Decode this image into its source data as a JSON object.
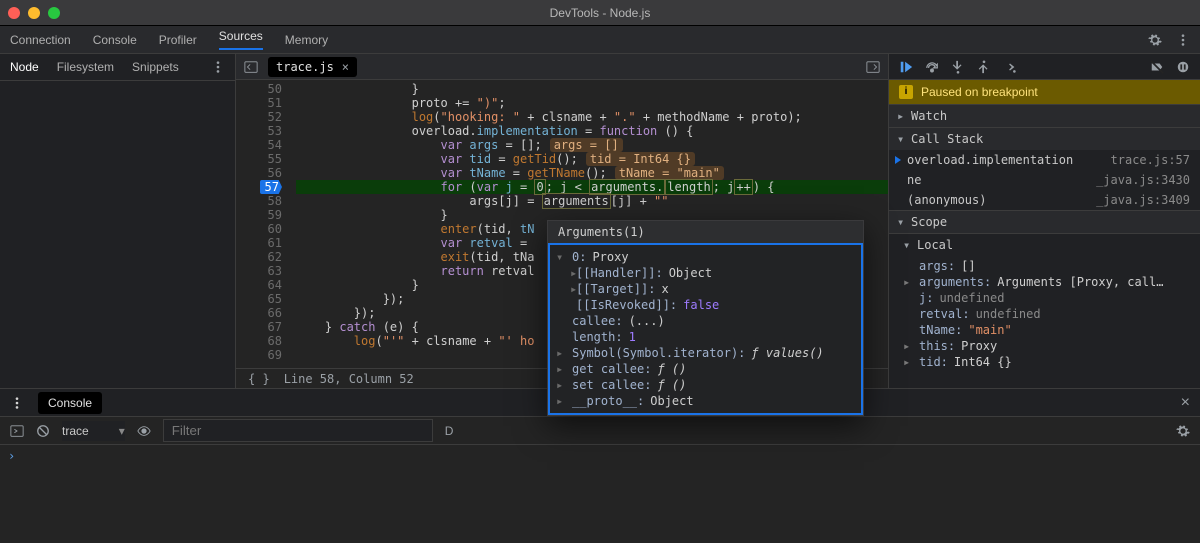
{
  "window": {
    "title": "DevTools - Node.js"
  },
  "mainTabs": [
    "Connection",
    "Console",
    "Profiler",
    "Sources",
    "Memory"
  ],
  "mainTabActive": 3,
  "subTabs": [
    "Node",
    "Filesystem",
    "Snippets"
  ],
  "subTabActive": 0,
  "fileTab": {
    "name": "trace.js"
  },
  "status": "Line 58, Column 52",
  "paused": "Paused on breakpoint",
  "watch": "Watch",
  "callStackLabel": "Call Stack",
  "scopeLabel": "Scope",
  "callStack": [
    {
      "name": "overload.implementation",
      "loc": "trace.js:57",
      "current": true
    },
    {
      "name": "ne",
      "loc": "_java.js:3430",
      "current": false
    },
    {
      "name": "(anonymous)",
      "loc": "_java.js:3409",
      "current": false
    }
  ],
  "localLabel": "Local",
  "scope": [
    {
      "tri": "",
      "k": "args:",
      "v": "[]",
      "cls": "val"
    },
    {
      "tri": "▸",
      "k": "arguments:",
      "v": "Arguments [Proxy, call…",
      "cls": "val"
    },
    {
      "tri": "",
      "k": "j:",
      "v": "undefined",
      "cls": "undef"
    },
    {
      "tri": "",
      "k": "retval:",
      "v": "undefined",
      "cls": "undef"
    },
    {
      "tri": "",
      "k": "tName:",
      "v": "\"main\"",
      "cls": "str"
    },
    {
      "tri": "▸",
      "k": "this:",
      "v": "Proxy",
      "cls": "val"
    },
    {
      "tri": "▸",
      "k": "tid:",
      "v": "Int64 {}",
      "cls": "val"
    }
  ],
  "code": {
    "start": 50,
    "bpLine": 57,
    "lines": [
      {
        "n": 50,
        "indent": 16,
        "html": "}"
      },
      {
        "n": 51,
        "indent": 16,
        "html": "proto += <span class='tok-str'>\")\"</span>;"
      },
      {
        "n": 52,
        "indent": 16,
        "html": "<span class='tok-fn'>log</span>(<span class='tok-str'>\"hooking: \"</span> + clsname + <span class='tok-str'>\".\"</span> + methodName + proto);"
      },
      {
        "n": 53,
        "indent": 16,
        "html": "overload.<span class='tok-id'>implementation</span> = <span class='tok-kw'>function</span> () {"
      },
      {
        "n": 54,
        "indent": 20,
        "html": "<span class='tok-kw'>var</span> <span class='tok-id'>args</span> = [];<span class='inl'>args = []</span>"
      },
      {
        "n": 55,
        "indent": 20,
        "html": "<span class='tok-kw'>var</span> <span class='tok-id'>tid</span> = <span class='tok-fn'>getTid</span>();<span class='inl'>tid = Int64 {}</span>"
      },
      {
        "n": 56,
        "indent": 20,
        "html": "<span class='tok-kw'>var</span> <span class='tok-id'>tName</span> = <span class='tok-fn'>getTName</span>();<span class='inl'>tName = \"main\"</span>"
      },
      {
        "n": 57,
        "indent": 20,
        "exec": true,
        "html": "<span class='tok-kw'>for</span> (<span class='tok-kw'>var</span> <span class='tok-id'>j</span> = <span class='hl-box'>0</span>; j &lt; <span class='hl-box'>arguments.</span><span class='hl-box'>length</span>; j<span class='hl-box'>++</span>) {"
      },
      {
        "n": 58,
        "indent": 24,
        "html": "args[j] = <span class='hl-box'>arguments</span>[j] + <span class='tok-str'>\"\"</span>"
      },
      {
        "n": 59,
        "indent": 20,
        "html": "}"
      },
      {
        "n": 60,
        "indent": 20,
        "html": "<span class='tok-fn'>enter</span>(tid, <span class='tok-id'>tN</span>"
      },
      {
        "n": 61,
        "indent": 20,
        "html": "<span class='tok-kw'>var</span> <span class='tok-id'>retval</span> ="
      },
      {
        "n": 62,
        "indent": 20,
        "html": "<span class='tok-fn'>exit</span>(tid, tNa"
      },
      {
        "n": 63,
        "indent": 20,
        "html": "<span class='tok-kw'>return</span> retval"
      },
      {
        "n": 64,
        "indent": 16,
        "html": "}"
      },
      {
        "n": 65,
        "indent": 12,
        "html": "});"
      },
      {
        "n": 66,
        "indent": 8,
        "html": "});"
      },
      {
        "n": 67,
        "indent": 4,
        "html": "} <span class='tok-kw'>catch</span> (e) {"
      },
      {
        "n": 68,
        "indent": 8,
        "html": "<span class='tok-fn'>log</span>(<span class='tok-str'>\"'\"</span> + clsname + <span class='tok-str'>\"' ho</span>"
      },
      {
        "n": 69,
        "indent": 4,
        "html": ""
      }
    ]
  },
  "tooltip": {
    "title": "Arguments(1)",
    "rows": [
      {
        "tri": "▾",
        "k": "0:",
        "v": "Proxy",
        "cls": "v"
      },
      {
        "tri": "▸",
        "k": "[[Handler]]:",
        "v": "Object",
        "cls": "v",
        "pad": 1
      },
      {
        "tri": "▸",
        "k": "[[Target]]:",
        "v": "x",
        "cls": "v",
        "pad": 1
      },
      {
        "tri": "",
        "k": "[[IsRevoked]]:",
        "v": "false",
        "cls": "bool",
        "pad": 1
      },
      {
        "tri": "",
        "k": "callee:",
        "v": "(...)",
        "cls": "v"
      },
      {
        "tri": "",
        "k": "length:",
        "v": "1",
        "cls": "num"
      },
      {
        "tri": "▸",
        "k": "Symbol(Symbol.iterator):",
        "v": "ƒ values()",
        "cls": "v i"
      },
      {
        "tri": "▸",
        "k": "get callee:",
        "v": "ƒ ()",
        "cls": "v i"
      },
      {
        "tri": "▸",
        "k": "set callee:",
        "v": "ƒ ()",
        "cls": "v i"
      },
      {
        "tri": "▸",
        "k": "__proto__:",
        "v": "Object",
        "cls": "v"
      }
    ]
  },
  "console": {
    "tab": "Console",
    "context": "trace",
    "filterPlaceholder": "Filter",
    "levelPlaceholder": "D",
    "prompt": "›"
  }
}
